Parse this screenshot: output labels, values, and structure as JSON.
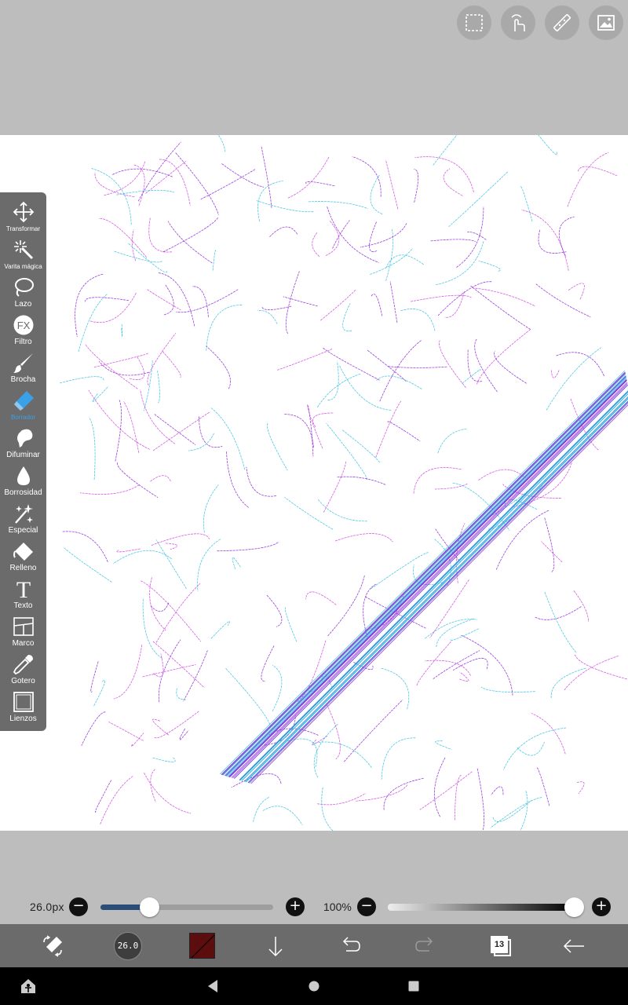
{
  "top_actions": [
    {
      "name": "selection-icon"
    },
    {
      "name": "touch-gesture-icon"
    },
    {
      "name": "ruler-icon"
    },
    {
      "name": "image-import-icon"
    }
  ],
  "tools": [
    {
      "label": "Transformar",
      "icon": "move-arrows-icon"
    },
    {
      "label": "Varita mágica",
      "icon": "magic-wand-icon"
    },
    {
      "label": "Lazo",
      "icon": "lasso-icon"
    },
    {
      "label": "Filtro",
      "icon": "fx-icon",
      "icon_text": "FX"
    },
    {
      "label": "Brocha",
      "icon": "brush-icon"
    },
    {
      "label": "Borrador",
      "icon": "eraser-icon",
      "active": true
    },
    {
      "label": "Difuminar",
      "icon": "smudge-icon"
    },
    {
      "label": "Borrosidad",
      "icon": "blur-drop-icon"
    },
    {
      "label": "Especial",
      "icon": "sparkle-icon"
    },
    {
      "label": "Relleno",
      "icon": "fill-bucket-icon"
    },
    {
      "label": "Texto",
      "icon": "text-icon",
      "icon_text": "T"
    },
    {
      "label": "Marco",
      "icon": "frame-icon"
    },
    {
      "label": "Gotero",
      "icon": "eyedropper-icon"
    },
    {
      "label": "Lienzos",
      "icon": "canvas-icon"
    }
  ],
  "brush_size": {
    "label": "26.0px",
    "value": 26.0,
    "fraction": 0.28,
    "minus": "−",
    "plus": "+"
  },
  "opacity": {
    "label": "100%",
    "value": 100,
    "minus": "−",
    "plus": "+"
  },
  "bottom": {
    "brush_preview_text": "26.0",
    "color": "#5c0d0d",
    "layer_count": "13"
  },
  "colors": {
    "accent": "#3aa0e8",
    "toolbar": "#6b6b6b",
    "stroke_pink": "#d040e0",
    "stroke_cyan": "#30c0e0",
    "stroke_purple": "#8a20d8"
  }
}
